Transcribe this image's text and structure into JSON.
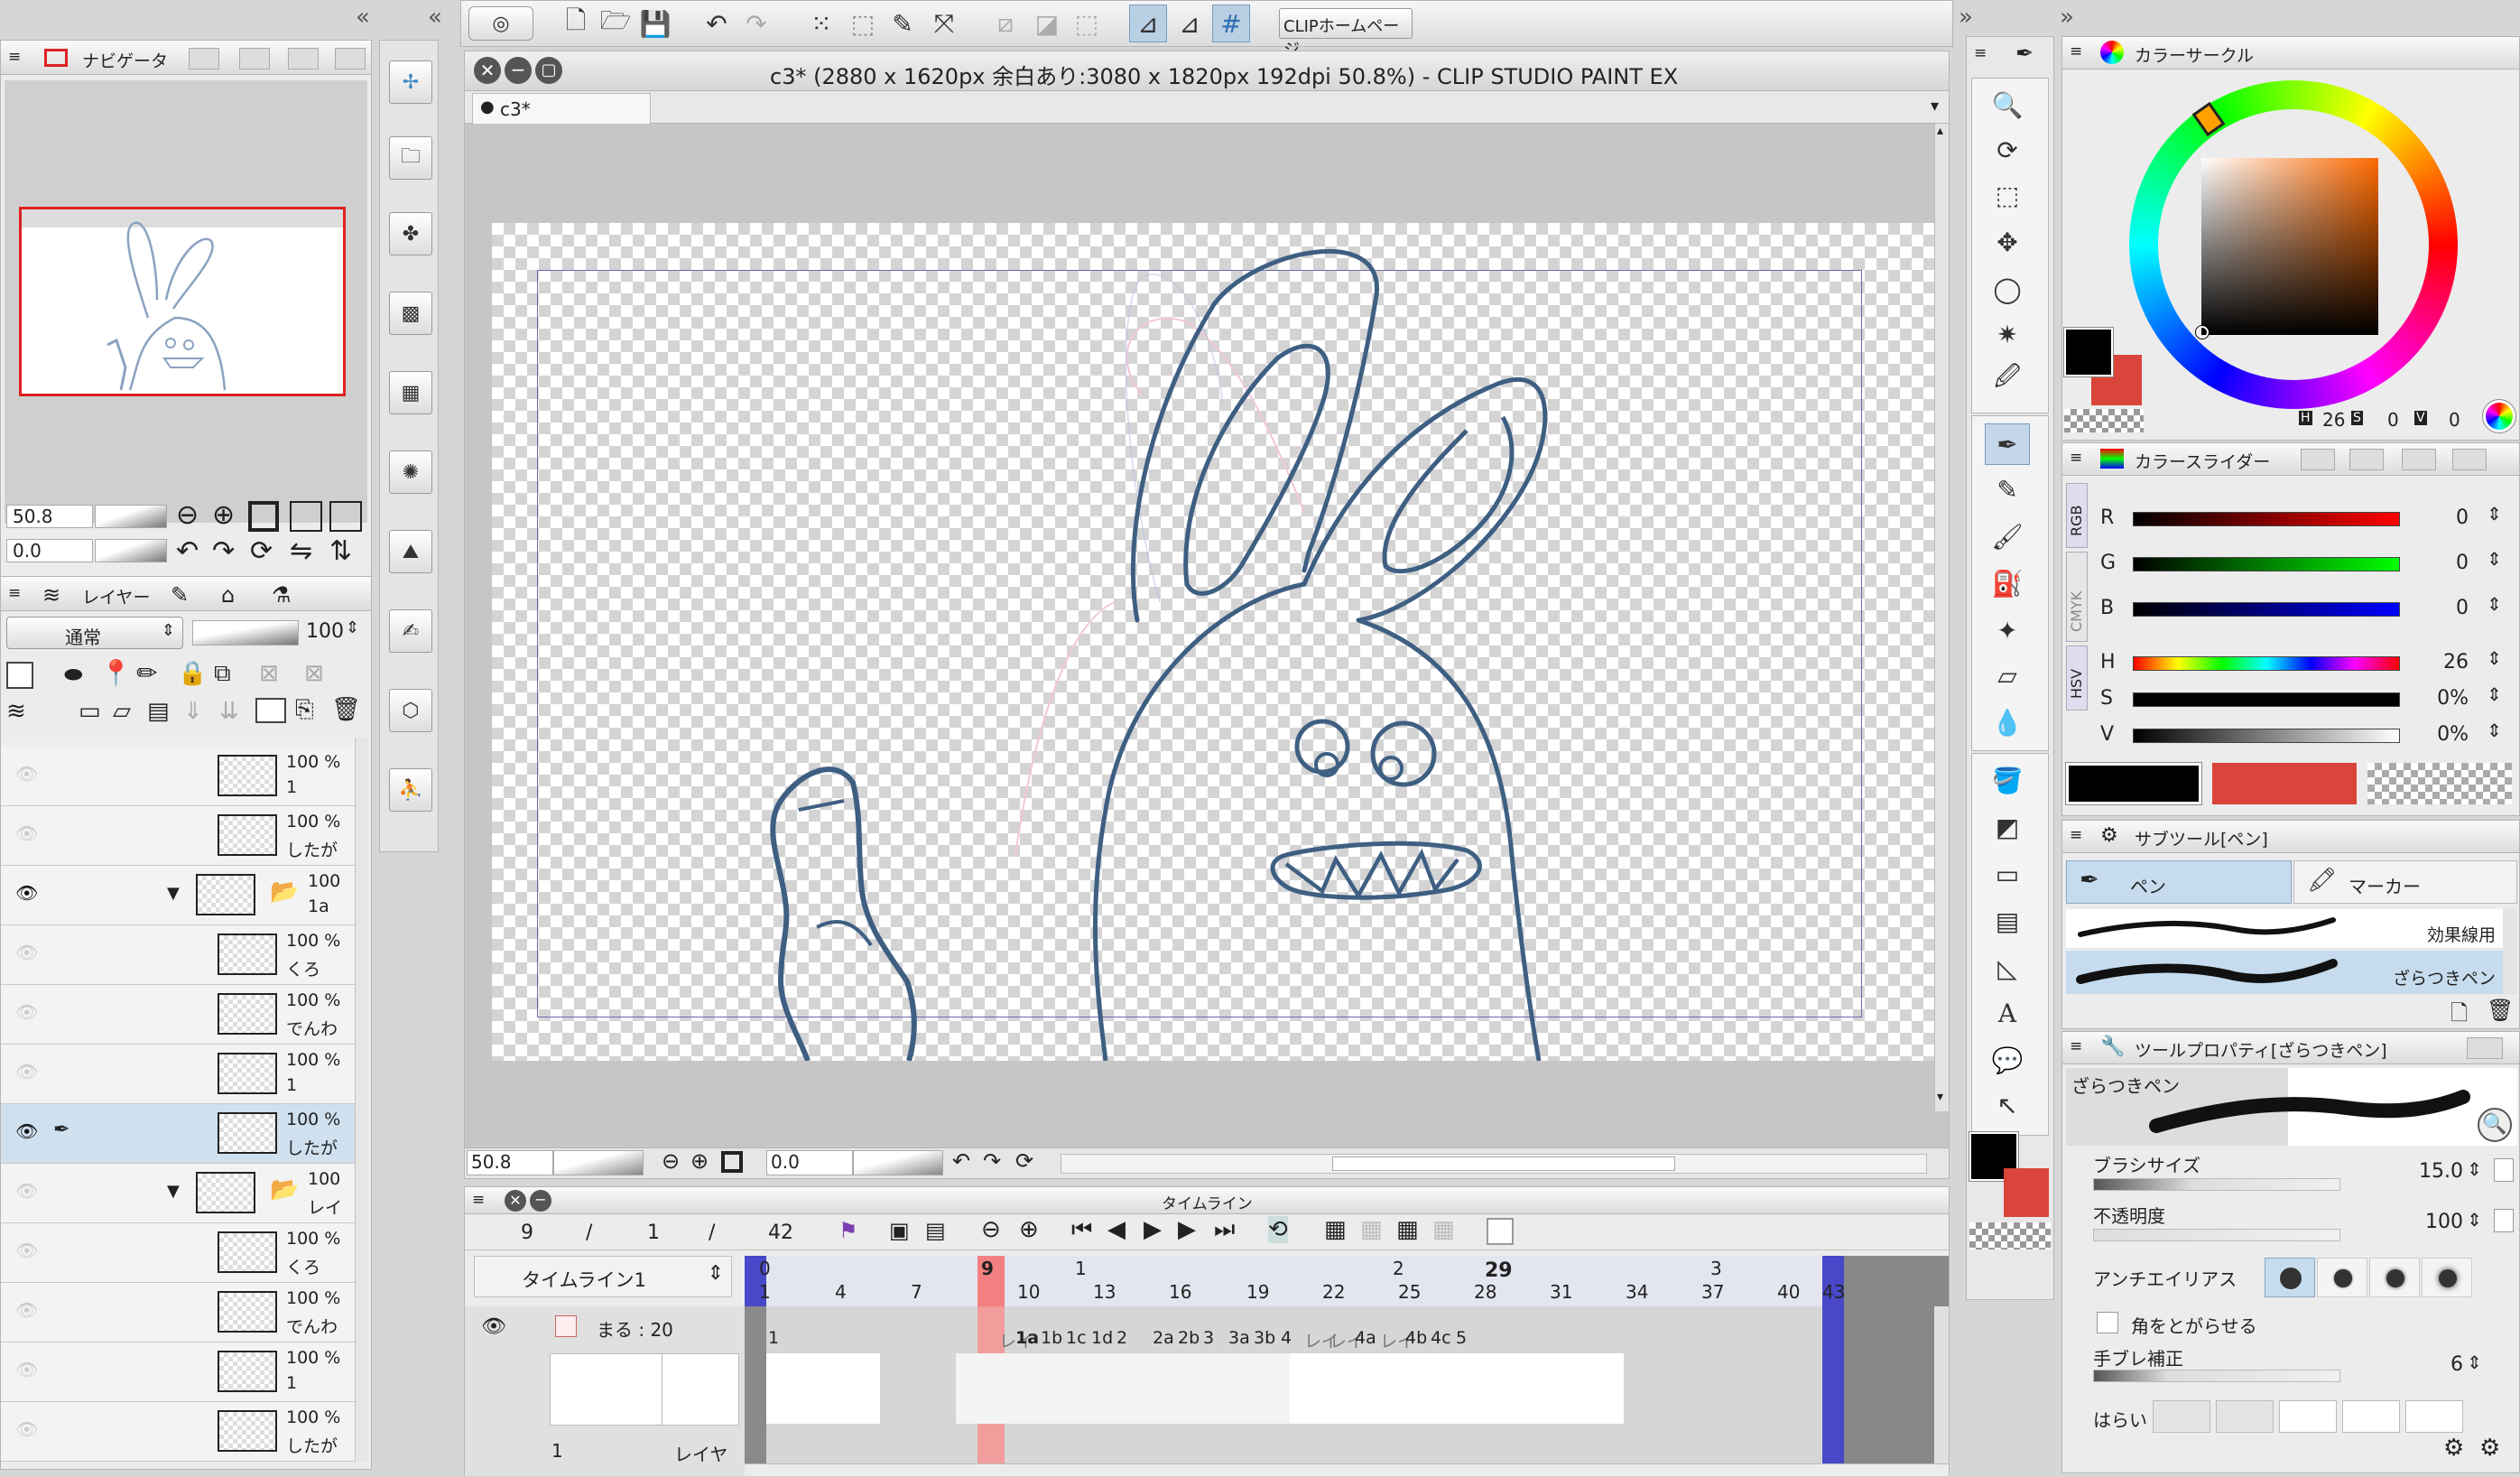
{
  "window": {
    "title": "c3* (2880 x 1620px 余白あり:3080 x 1820px 192dpi 50.8%)  - CLIP STUDIO PAINT EX",
    "doc_tab": "c3*"
  },
  "toolbar": {
    "clip_home": "CLIPホームページ"
  },
  "navigator": {
    "tab": "ナビゲータ",
    "zoom": "50.8",
    "rotation": "0.0"
  },
  "layer_panel": {
    "tab": "レイヤー",
    "blend_mode": "通常",
    "opacity": "100",
    "layers": [
      {
        "pct": "100 %",
        "name": "1",
        "eye": false,
        "folder": false
      },
      {
        "pct": "100 %",
        "name": "したが",
        "eye": false,
        "folder": false
      },
      {
        "pct": "100",
        "name": "1a",
        "eye": true,
        "folder": true
      },
      {
        "pct": "100 %",
        "name": "くろ",
        "eye": false,
        "folder": false
      },
      {
        "pct": "100 %",
        "name": "でんわ",
        "eye": false,
        "folder": false
      },
      {
        "pct": "100 %",
        "name": "1",
        "eye": false,
        "folder": false
      },
      {
        "pct": "100 %",
        "name": "したが",
        "eye": true,
        "folder": false
      },
      {
        "pct": "100",
        "name": "レイ",
        "eye": false,
        "folder": true
      },
      {
        "pct": "100 %",
        "name": "くろ",
        "eye": false,
        "folder": false
      },
      {
        "pct": "100 %",
        "name": "でんわ",
        "eye": false,
        "folder": false
      },
      {
        "pct": "100 %",
        "name": "1",
        "eye": false,
        "folder": false
      },
      {
        "pct": "100 %",
        "name": "したが",
        "eye": false,
        "folder": false
      }
    ]
  },
  "canvas": {
    "zoom": "50.8",
    "rotation": "0.0"
  },
  "timeline": {
    "title": "タイムライン",
    "current_frame": "9",
    "slash1": "/",
    "page": "1",
    "slash2": "/",
    "total": "42",
    "name": "タイムライン1",
    "track_name": "まる : 20",
    "footer_left": "1",
    "footer_mid": "レイヤ",
    "seconds": [
      "0",
      "1",
      "2",
      "3"
    ],
    "frame_numbers": [
      "1",
      "4",
      "7",
      "9",
      "10",
      "13",
      "16",
      "19",
      "22",
      "25",
      "28",
      "31",
      "34",
      "37",
      "40",
      "43"
    ],
    "highlight_frame": "29",
    "cels": [
      "1",
      "レイ",
      "1a",
      "1b",
      "1c",
      "1d",
      "2",
      "2a",
      "2b",
      "3",
      "3a",
      "3b",
      "4",
      "レイ",
      "レイ",
      "4a",
      "レイ",
      "4b",
      "4c",
      "5"
    ]
  },
  "color_circle": {
    "tab": "カラーサークル",
    "h_label": "H",
    "h": "26",
    "s_label": "S",
    "s": "0",
    "v_label": "V",
    "v": "0",
    "main_color": "#000000",
    "sub_color": "#d9453a"
  },
  "color_slider": {
    "tab": "カラースライダー",
    "side_tabs": [
      "RGB",
      "CMYK",
      "HSV"
    ],
    "rgb": [
      {
        "label": "R",
        "value": "0"
      },
      {
        "label": "G",
        "value": "0"
      },
      {
        "label": "B",
        "value": "0"
      }
    ],
    "hsv": [
      {
        "label": "H",
        "value": "26"
      },
      {
        "label": "S",
        "value": "0%"
      },
      {
        "label": "V",
        "value": "0%"
      }
    ]
  },
  "subtool": {
    "tab": "サブツール[ペン]",
    "groups": [
      "ペン",
      "マーカー"
    ],
    "brushes": [
      "効果線用",
      "ざらつきペン"
    ]
  },
  "tool_property": {
    "tab": "ツールプロパティ[ざらつきペン]",
    "brush_name": "ざらつきペン",
    "rows": [
      {
        "label": "ブラシサイズ",
        "value": "15.0"
      },
      {
        "label": "不透明度",
        "value": "100"
      },
      {
        "label": "アンチエイリアス",
        "value": ""
      },
      {
        "label": "角をとがらせる",
        "value": ""
      },
      {
        "label": "手ブレ補正",
        "value": "6"
      },
      {
        "label": "はらい",
        "value": ""
      }
    ]
  },
  "icons": [
    "chevron-double-left-icon",
    "chevron-double-right-icon",
    "eye-icon",
    "folder-icon",
    "pen-icon",
    "play-icon",
    "magnify-icon"
  ]
}
